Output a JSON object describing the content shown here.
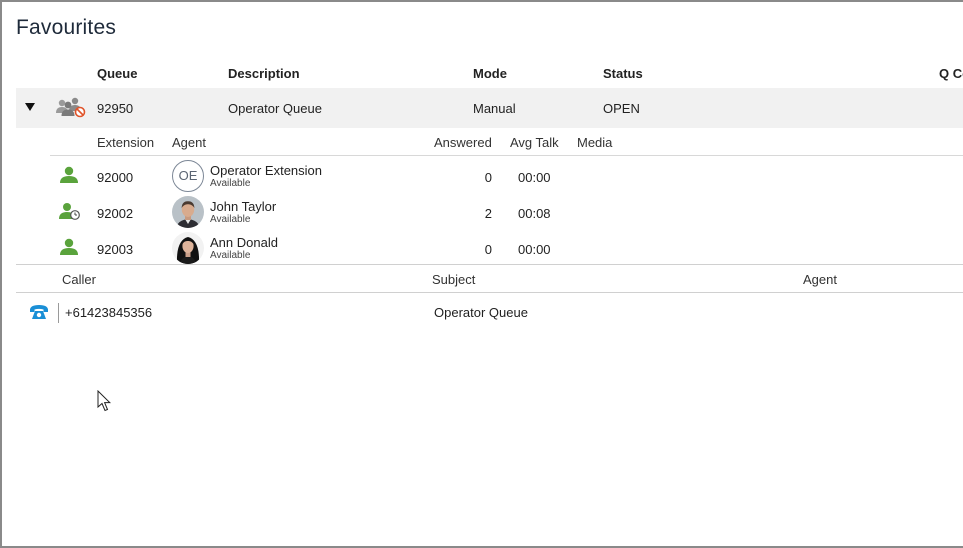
{
  "page": {
    "title": "Favourites"
  },
  "queue_table": {
    "headers": {
      "queue": "Queue",
      "description": "Description",
      "mode": "Mode",
      "status": "Status",
      "q_count": "Q Co"
    },
    "row": {
      "queue": "92950",
      "description": "Operator Queue",
      "mode": "Manual",
      "status": "OPEN"
    }
  },
  "agents_table": {
    "headers": {
      "extension": "Extension",
      "agent": "Agent",
      "answered": "Answered",
      "avg_talk": "Avg Talk",
      "media": "Media"
    },
    "rows": [
      {
        "extension": "92000",
        "initials": "OE",
        "name": "Operator Extension",
        "status": "Available",
        "answered": "0",
        "avg_talk": "00:00"
      },
      {
        "extension": "92002",
        "name": "John Taylor",
        "status": "Available",
        "answered": "2",
        "avg_talk": "00:08"
      },
      {
        "extension": "92003",
        "name": "Ann Donald",
        "status": "Available",
        "answered": "0",
        "avg_talk": "00:00"
      }
    ]
  },
  "calls_table": {
    "headers": {
      "caller": "Caller",
      "subject": "Subject",
      "agent": "Agent"
    },
    "rows": [
      {
        "caller": "+61423845356",
        "subject": "Operator Queue"
      }
    ]
  },
  "colors": {
    "presence_green": "#5aa33c",
    "phone_blue": "#1a8fd6",
    "row_bg": "#f1f1f1"
  }
}
